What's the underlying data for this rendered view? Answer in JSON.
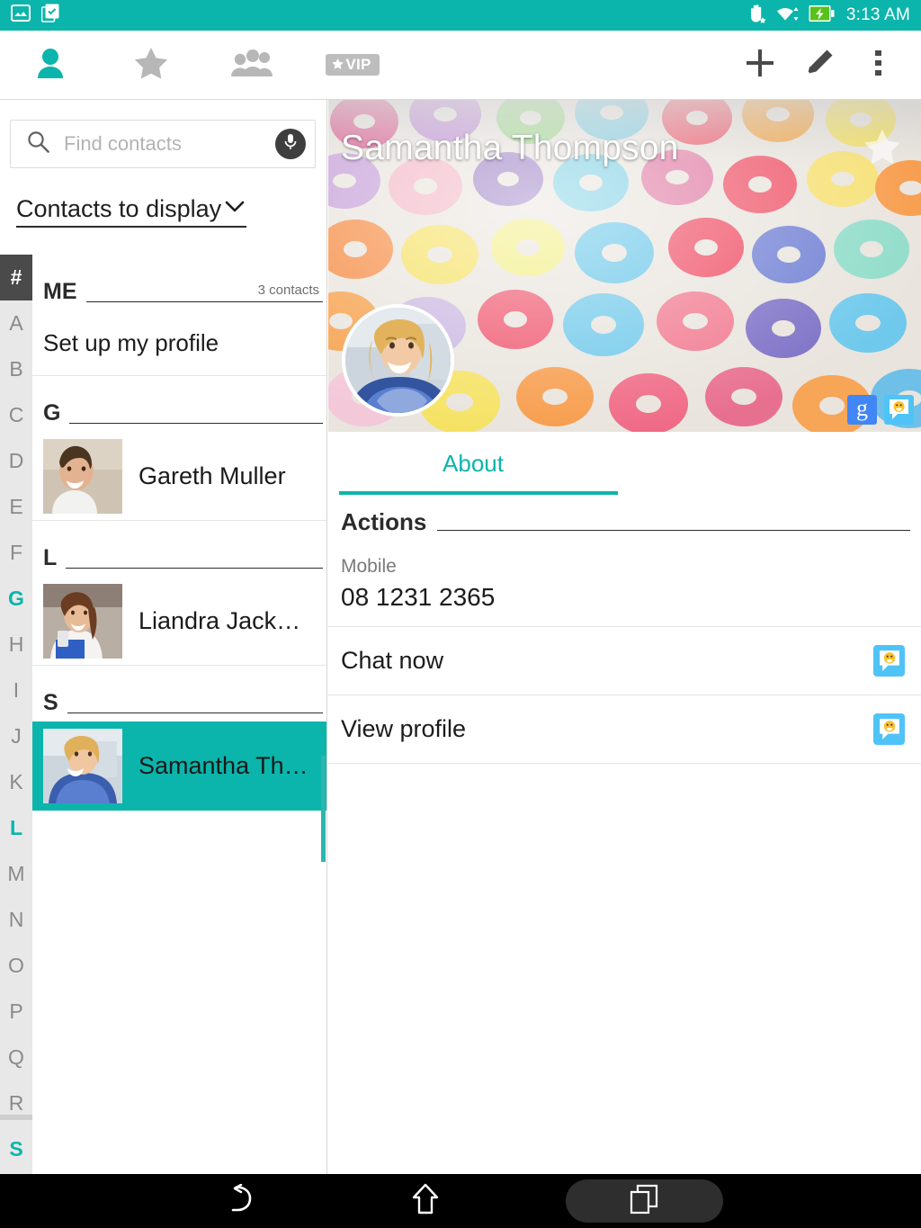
{
  "statusbar": {
    "left_icons": [
      "photo-icon",
      "clipboard-check-icon"
    ],
    "right_icons": [
      "hand-gesture-star-icon",
      "wifi-icon",
      "battery-charging-icon"
    ],
    "time": "3:13 AM",
    "background": "#0bb5ab"
  },
  "appbar": {
    "tabs": [
      {
        "name": "contacts",
        "icon": "person-icon",
        "active": true
      },
      {
        "name": "favorites",
        "icon": "star-icon",
        "active": false
      },
      {
        "name": "groups",
        "icon": "group-icon",
        "active": false
      },
      {
        "name": "vip",
        "icon": "vip-badge-icon",
        "label": "VIP",
        "active": false
      }
    ],
    "actions": [
      {
        "name": "add",
        "icon": "plus-icon"
      },
      {
        "name": "edit",
        "icon": "pencil-icon"
      },
      {
        "name": "overflow",
        "icon": "more-vertical-icon"
      }
    ]
  },
  "search": {
    "placeholder": "Find contacts",
    "value": "",
    "search_icon": "search-icon",
    "mic_icon": "microphone-icon"
  },
  "filter": {
    "label": "Contacts to display",
    "chevron": "chevron-down-icon"
  },
  "alpha_index": {
    "items": [
      "#",
      "A",
      "B",
      "C",
      "D",
      "E",
      "F",
      "G",
      "H",
      "I",
      "J",
      "K",
      "L",
      "M",
      "N",
      "O",
      "P",
      "Q",
      "R",
      "S"
    ],
    "selected": "#",
    "highlighted": [
      "G",
      "L",
      "S"
    ],
    "highlight_color": "#0bb5ab"
  },
  "contacts_list": {
    "sections": [
      {
        "letter": "ME",
        "count": "3 contacts",
        "rows": [
          {
            "type": "text",
            "label": "Set up my profile"
          }
        ]
      },
      {
        "letter": "G",
        "count": "",
        "rows": [
          {
            "type": "contact",
            "name": "Gareth Muller",
            "avatar": "man-smiling-photo",
            "selected": false
          }
        ]
      },
      {
        "letter": "L",
        "count": "",
        "rows": [
          {
            "type": "contact",
            "name": "Liandra Jack…",
            "avatar": "woman-phone-photo",
            "selected": false
          }
        ]
      },
      {
        "letter": "S",
        "count": "",
        "rows": [
          {
            "type": "contact",
            "name": "Samantha Th…",
            "avatar": "woman-plaid-photo",
            "selected": true
          }
        ]
      }
    ]
  },
  "detail": {
    "name": "Samantha Thompson",
    "cover_image": "colorful-cereal-loops-photo",
    "avatar_image": "woman-plaid-photo",
    "favorite_icon": "star-icon",
    "badges": [
      {
        "name": "google-account-badge",
        "label": "g"
      },
      {
        "name": "hangouts-account-badge",
        "label": ""
      }
    ],
    "tabs": [
      {
        "label": "About",
        "active": true
      }
    ],
    "sections": [
      {
        "title": "Actions",
        "fields": [
          {
            "label": "Mobile",
            "value": "08 1231 2365"
          }
        ],
        "rows": [
          {
            "label": "Chat now",
            "icon": "hangouts-icon"
          },
          {
            "label": "View profile",
            "icon": "hangouts-icon"
          }
        ]
      }
    ]
  },
  "navbar": {
    "buttons": [
      {
        "name": "back",
        "icon": "back-arrow-icon",
        "active": false
      },
      {
        "name": "home",
        "icon": "home-icon",
        "active": false
      },
      {
        "name": "recents",
        "icon": "recent-apps-icon",
        "active": true
      }
    ]
  },
  "theme": {
    "accent": "#0bb5ab",
    "surface": "#ffffff",
    "index_bg": "#e8e8e8"
  }
}
